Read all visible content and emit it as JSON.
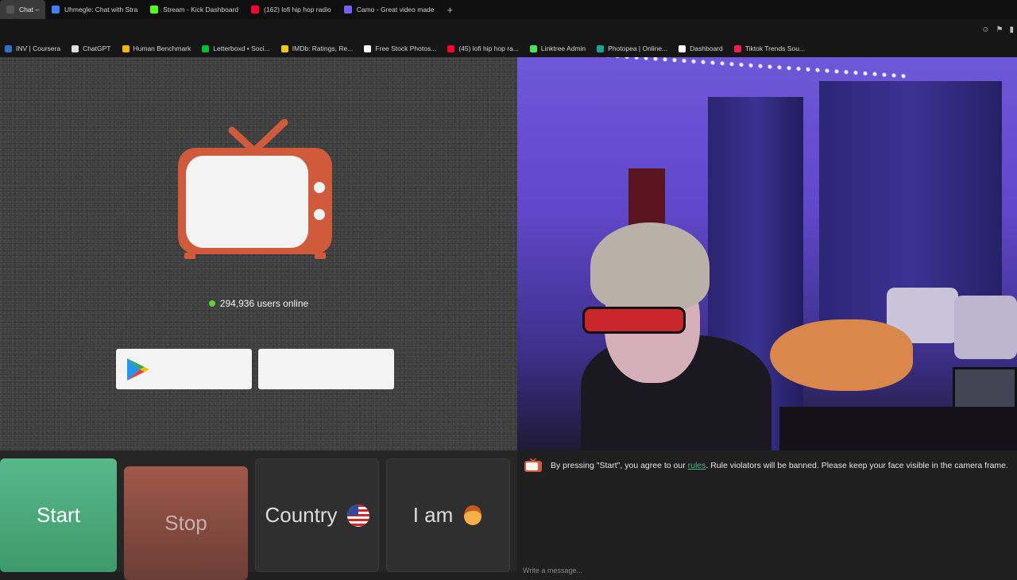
{
  "browser": {
    "tabs": [
      {
        "label": "Chat –",
        "active": true,
        "color": "#555"
      },
      {
        "label": "Uhmegle: Chat with Stra",
        "color": "#3b82f6"
      },
      {
        "label": "Stream - Kick Dashboard",
        "color": "#53fc18"
      },
      {
        "label": "(162) lofi hip hop radio",
        "color": "#ff0033"
      },
      {
        "label": "Camo - Great video made",
        "color": "#7c5cff"
      }
    ],
    "new_tab": "+",
    "bookmarks": [
      {
        "label": "INV | Coursera",
        "color": "#2a73cc"
      },
      {
        "label": "ChatGPT",
        "color": "#ddd"
      },
      {
        "label": "Human Benchmark",
        "color": "#f5b700"
      },
      {
        "label": "Letterboxd • Soci...",
        "color": "#00c030"
      },
      {
        "label": "IMDb: Ratings, Re...",
        "color": "#f5c518"
      },
      {
        "label": "Free Stock Photos...",
        "color": "#ffffff"
      },
      {
        "label": "(45) lofi hip hop ra...",
        "color": "#ff0033"
      },
      {
        "label": "Linktree Admin",
        "color": "#43e660"
      },
      {
        "label": "Photopea | Online...",
        "color": "#18a497"
      },
      {
        "label": "Dashboard",
        "color": "#ffffff"
      },
      {
        "label": "Tiktok Trends Sou...",
        "color": "#ee1d52"
      }
    ]
  },
  "stranger_panel": {
    "online_count": "294,936 users online",
    "tv_color": "#cf5a3c"
  },
  "controls": {
    "start_label": "Start",
    "stop_label": "Stop",
    "country_label": "Country",
    "iam_label": "I am"
  },
  "chat": {
    "notice_before": "By pressing \"Start\", you agree to our ",
    "rules_link": "rules",
    "notice_after": ". Rule violators will be banned. Please keep your face visible in the camera frame.",
    "placeholder": "Write a message..."
  },
  "colors": {
    "start_green": "#4caf7d",
    "stop_red": "#8b4a3f",
    "online_green": "#5fd436"
  }
}
